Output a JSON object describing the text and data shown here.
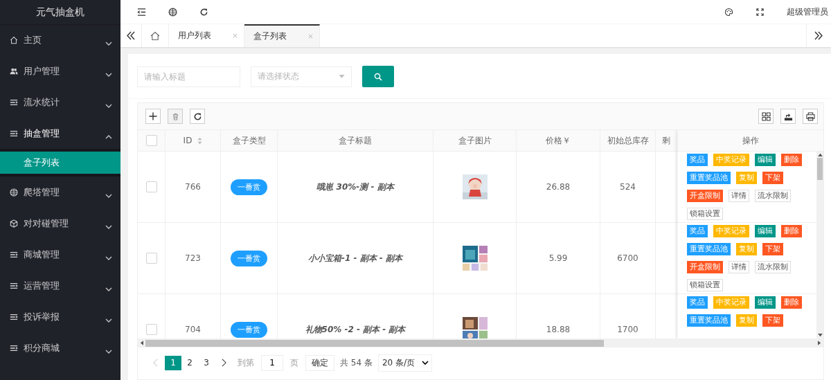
{
  "sidebar": {
    "title": "元气抽盒机",
    "items": [
      {
        "label": "主页",
        "kind": "home",
        "expanded": false
      },
      {
        "label": "用户管理",
        "kind": "users",
        "expanded": false
      },
      {
        "label": "流水统计",
        "kind": "list",
        "expanded": false
      },
      {
        "label": "抽盒管理",
        "kind": "list",
        "expanded": true,
        "children": [
          {
            "label": "盒子列表",
            "selected": true
          }
        ]
      },
      {
        "label": "爬塔管理",
        "kind": "globe",
        "expanded": false
      },
      {
        "label": "对对碰管理",
        "kind": "cube",
        "expanded": false
      },
      {
        "label": "商城管理",
        "kind": "list",
        "expanded": false
      },
      {
        "label": "运营管理",
        "kind": "list",
        "expanded": false
      },
      {
        "label": "投诉举报",
        "kind": "list",
        "expanded": false
      },
      {
        "label": "积分商城",
        "kind": "list",
        "expanded": false
      }
    ]
  },
  "header": {
    "user": "超级管理员"
  },
  "tabs": [
    {
      "label": "用户列表",
      "selected": false
    },
    {
      "label": "盒子列表",
      "selected": true
    }
  ],
  "search": {
    "title_placeholder": "请输入标题",
    "status_placeholder": "请选择状态"
  },
  "table": {
    "columns": [
      "ID",
      "盒子类型",
      "盒子标题",
      "盒子图片",
      "价格￥",
      "初始总库存",
      "剩"
    ],
    "actions_column": "操作",
    "all_checked": false,
    "rows": [
      {
        "id": "766",
        "type": "一番赏",
        "title": "哦崽 30%-测 - 副本",
        "price": "26.88",
        "stock": "524",
        "checked": false,
        "actions": [
          {
            "label": "奖品",
            "kind": "info"
          },
          {
            "label": "中奖记录",
            "kind": "warn"
          },
          {
            "label": "编辑",
            "kind": "primary"
          },
          {
            "label": "删除",
            "kind": "danger"
          },
          {
            "label": "重置奖品池",
            "kind": "info"
          },
          {
            "label": "复制",
            "kind": "warn"
          },
          {
            "label": "下架",
            "kind": "danger"
          },
          {
            "label": "开盒限制",
            "kind": "danger"
          },
          {
            "label": "详情",
            "kind": "plain"
          },
          {
            "label": "流水限制",
            "kind": "plain"
          },
          {
            "label": "锁箱设置",
            "kind": "plain"
          }
        ]
      },
      {
        "id": "723",
        "type": "一番赏",
        "title": "小小宝箱-1 - 副本 - 副本",
        "price": "5.99",
        "stock": "6700",
        "checked": false,
        "actions": [
          {
            "label": "奖品",
            "kind": "info"
          },
          {
            "label": "中奖记录",
            "kind": "warn"
          },
          {
            "label": "编辑",
            "kind": "primary"
          },
          {
            "label": "删除",
            "kind": "danger"
          },
          {
            "label": "重置奖品池",
            "kind": "info"
          },
          {
            "label": "复制",
            "kind": "warn"
          },
          {
            "label": "下架",
            "kind": "danger"
          },
          {
            "label": "开盒限制",
            "kind": "danger"
          },
          {
            "label": "详情",
            "kind": "plain"
          },
          {
            "label": "流水限制",
            "kind": "plain"
          },
          {
            "label": "锁箱设置",
            "kind": "plain"
          }
        ]
      },
      {
        "id": "704",
        "type": "一番赏",
        "title": "礼物50% -2 - 副本 - 副本",
        "price": "18.88",
        "stock": "1700",
        "checked": false,
        "actions": [
          {
            "label": "奖品",
            "kind": "info"
          },
          {
            "label": "中奖记录",
            "kind": "warn"
          },
          {
            "label": "编辑",
            "kind": "primary"
          },
          {
            "label": "删除",
            "kind": "danger"
          },
          {
            "label": "重置奖品池",
            "kind": "info"
          },
          {
            "label": "复制",
            "kind": "warn"
          },
          {
            "label": "下架",
            "kind": "danger"
          }
        ]
      }
    ]
  },
  "pagination": {
    "pages": [
      {
        "label": "1",
        "selected": true
      },
      {
        "label": "2",
        "selected": false
      },
      {
        "label": "3",
        "selected": false
      }
    ],
    "goto_label": "到第",
    "goto_value": "1",
    "page_unit": "页",
    "confirm": "确定",
    "total": "共 54 条",
    "page_size": "20 条/页"
  }
}
